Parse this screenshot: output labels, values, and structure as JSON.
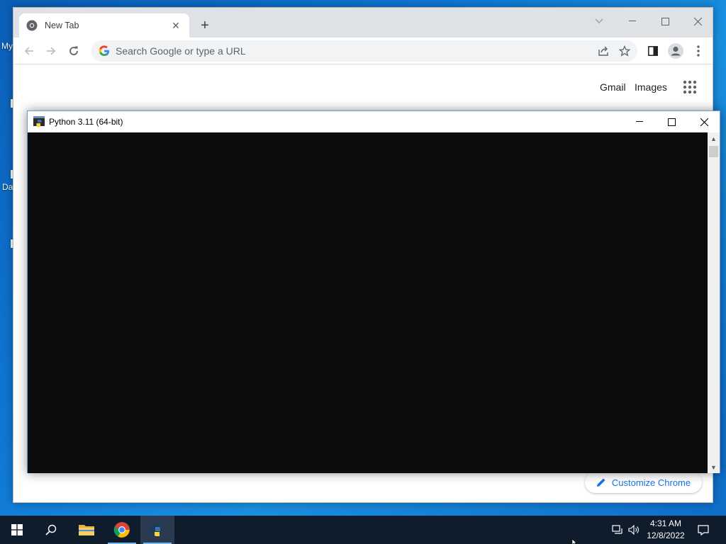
{
  "desktop": {
    "icon_labels": [
      "My",
      "Da"
    ]
  },
  "chrome": {
    "tab": {
      "title": "New Tab",
      "favicon": "chrome-icon"
    },
    "new_tab_symbol": "+",
    "omnibox": {
      "placeholder": "Search Google or type a URL",
      "value": ""
    },
    "ntp": {
      "links": [
        "Gmail",
        "Images"
      ],
      "customize_label": "Customize Chrome"
    }
  },
  "python_console": {
    "title": "Python 3.11 (64-bit)",
    "background": "#0c0c0c"
  },
  "taskbar": {
    "apps": [
      "windows-start-icon",
      "search-icon",
      "file-explorer-icon",
      "chrome-icon",
      "python-icon"
    ],
    "active_app": "python-icon",
    "clock": {
      "time": "4:31 AM",
      "date": "12/8/2022"
    }
  },
  "colors": {
    "desktop": "#0f78d4",
    "accent_blue": "#1a73e8",
    "taskbar": "#0f1c2c"
  }
}
